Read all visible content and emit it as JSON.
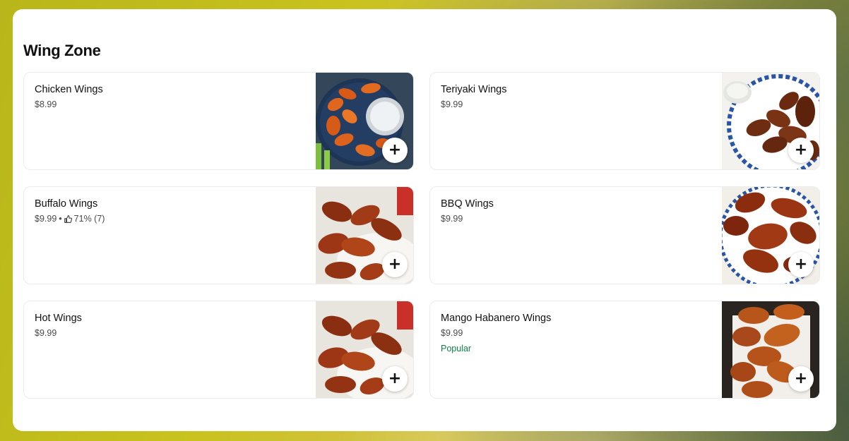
{
  "section": {
    "title": "Wing Zone"
  },
  "add_label": "+",
  "items": [
    {
      "name": "Chicken Wings",
      "price": "$8.99",
      "rating": null,
      "badge": null,
      "photo": "chicken-wings-photo"
    },
    {
      "name": "Teriyaki Wings",
      "price": "$9.99",
      "rating": null,
      "badge": null,
      "photo": "teriyaki-wings-photo"
    },
    {
      "name": "Buffalo Wings",
      "price": "$9.99",
      "separator": "•",
      "rating": "71% (7)",
      "badge": null,
      "photo": "buffalo-wings-photo"
    },
    {
      "name": "BBQ Wings",
      "price": "$9.99",
      "rating": null,
      "badge": null,
      "photo": "bbq-wings-photo"
    },
    {
      "name": "Hot Wings",
      "price": "$9.99",
      "rating": null,
      "badge": null,
      "photo": "hot-wings-photo"
    },
    {
      "name": "Mango Habanero Wings",
      "price": "$9.99",
      "rating": null,
      "badge": "Popular",
      "photo": "mango-habanero-wings-photo"
    }
  ],
  "colors": {
    "popular_badge": "#0e8345"
  }
}
